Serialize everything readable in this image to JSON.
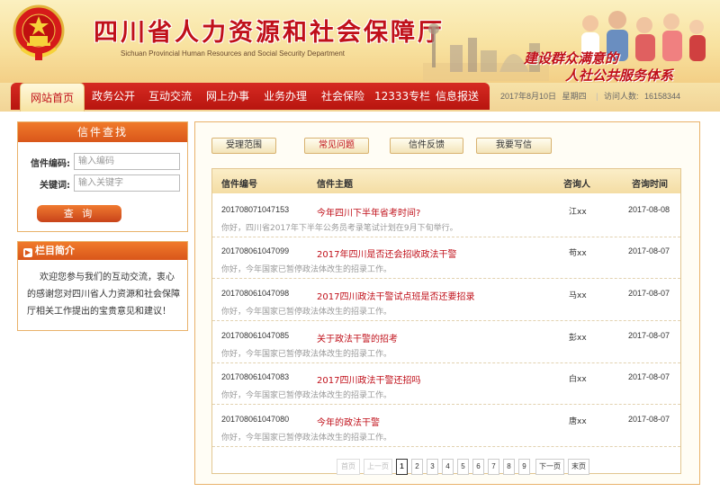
{
  "header": {
    "site_title": "四川省人力资源和社会保障厅",
    "site_title_en": "Sichuan Provincial Human Resources and Social Security Department",
    "slogan_line1": "建设群众满意的",
    "slogan_line2": "人社公共服务体系",
    "emblem_icon": "national-emblem-icon",
    "colors": {
      "brand_red": "#c0101a",
      "banner_bg": "#f8e2a0"
    }
  },
  "nav": {
    "home": "网站首页",
    "items": [
      "政务公开",
      "互动交流",
      "网上办事",
      "业务办理",
      "社会保险",
      "12333专栏",
      "信息报送"
    ],
    "date": "2017年8月10日",
    "weekday": "星期四",
    "visitors_label": "访问人数:",
    "visitors_count": "16158344"
  },
  "search_box": {
    "title": "信件查找",
    "code_label": "信件编码:",
    "code_placeholder": "输入编码",
    "keyword_label": "关键词:",
    "keyword_placeholder": "输入关键字",
    "button": "查 询"
  },
  "intro_box": {
    "title": "栏目简介",
    "text": "欢迎您参与我们的互动交流，衷心的感谢您对四川省人力资源和社会保障厅相关工作提出的宝贵意见和建议！"
  },
  "tabs": [
    {
      "label": "受理范围",
      "active": false
    },
    {
      "label": "常见问题",
      "active": true
    },
    {
      "label": "信件反馈",
      "active": false
    },
    {
      "label": "我要写信",
      "active": false
    }
  ],
  "table": {
    "headers": [
      "信件编号",
      "信件主题",
      "咨询人",
      "咨询时间"
    ],
    "rows": [
      {
        "code": "201708071047153",
        "subject": "今年四川下半年省考时间?",
        "asker": "江xx",
        "date": "2017-08-08",
        "reply": "你好，四川省2017年下半年公务员考录笔试计划在9月下旬举行。"
      },
      {
        "code": "201708061047099",
        "subject": "2017年四川是否还会招收政法干警",
        "asker": "苟xx",
        "date": "2017-08-07",
        "reply": "你好，今年国家已暂停政法体改生的招录工作。"
      },
      {
        "code": "201708061047098",
        "subject": "2017四川政法干警试点班是否还要招录",
        "asker": "马xx",
        "date": "2017-08-07",
        "reply": "你好，今年国家已暂停政法体改生的招录工作。"
      },
      {
        "code": "201708061047085",
        "subject": "关于政法干警的招考",
        "asker": "彭xx",
        "date": "2017-08-07",
        "reply": "你好，今年国家已暂停政法体改生的招录工作。"
      },
      {
        "code": "201708061047083",
        "subject": "2017四川政法干警还招吗",
        "asker": "白xx",
        "date": "2017-08-07",
        "reply": "你好，今年国家已暂停政法体改生的招录工作。"
      },
      {
        "code": "201708061047080",
        "subject": "今年的政法干警",
        "asker": "唐xx",
        "date": "2017-08-07",
        "reply": "你好，今年国家已暂停政法体改生的招录工作。"
      }
    ]
  },
  "pager": {
    "first": "首页",
    "prev": "上一页",
    "pages": [
      "1",
      "2",
      "3",
      "4",
      "5",
      "6",
      "7",
      "8",
      "9"
    ],
    "current": "1",
    "next": "下一页",
    "last": "末页"
  }
}
